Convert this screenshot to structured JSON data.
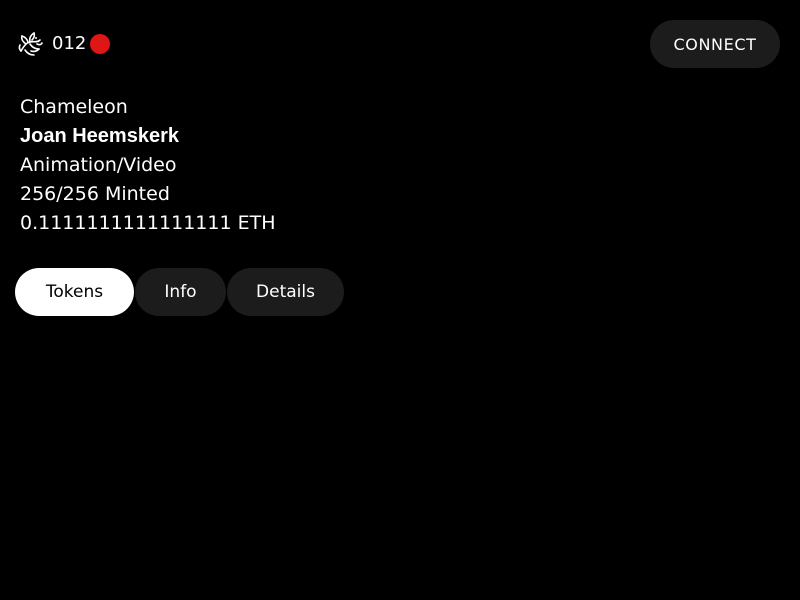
{
  "header": {
    "logo_icon": "dragon-logo-icon",
    "counter": "012",
    "live_indicator_color": "#e01515",
    "connect_label": "CONNECT"
  },
  "project": {
    "title": "Chameleon",
    "artist": "Joan Heemskerk",
    "medium": "Animation/Video",
    "minted": "256/256 Minted",
    "price": "0.1111111111111111 ETH"
  },
  "tabs": [
    {
      "label": "Tokens",
      "active": true
    },
    {
      "label": "Info",
      "active": false
    },
    {
      "label": "Details",
      "active": false
    }
  ],
  "colors": {
    "background": "#000000",
    "button_bg": "#1c1c1c",
    "active_tab_bg": "#ffffff",
    "text": "#ffffff"
  }
}
